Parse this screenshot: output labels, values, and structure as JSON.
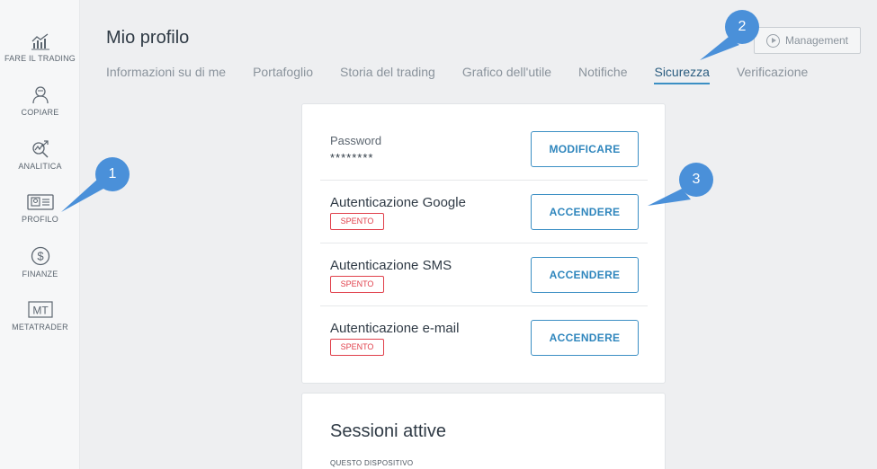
{
  "sidebar": {
    "items": [
      {
        "label": "FARE IL TRADING",
        "icon": "trading-chart-icon"
      },
      {
        "label": "COPIARE",
        "icon": "copy-user-icon"
      },
      {
        "label": "ANALITICA",
        "icon": "analytics-icon"
      },
      {
        "label": "PROFILO",
        "icon": "profile-card-icon"
      },
      {
        "label": "FINANZE",
        "icon": "dollar-icon"
      },
      {
        "label": "METATRADER",
        "icon": "mt-icon",
        "icon_text": "MT"
      }
    ]
  },
  "header": {
    "title": "Mio profilo",
    "management_label": "Management",
    "tabs": [
      {
        "label": "Informazioni su di me",
        "active": false
      },
      {
        "label": "Portafoglio",
        "active": false
      },
      {
        "label": "Storia del trading",
        "active": false
      },
      {
        "label": "Grafico dell'utile",
        "active": false
      },
      {
        "label": "Notifiche",
        "active": false
      },
      {
        "label": "Sicurezza",
        "active": true
      },
      {
        "label": "Verificazione",
        "active": false
      }
    ]
  },
  "security": {
    "password": {
      "label": "Password",
      "value": "********",
      "button": "MODIFICARE"
    },
    "google": {
      "label": "Autenticazione Google",
      "status": "SPENTO",
      "button": "ACCENDERE"
    },
    "sms": {
      "label": "Autenticazione SMS",
      "status": "SPENTO",
      "button": "ACCENDERE"
    },
    "email": {
      "label": "Autenticazione e-mail",
      "status": "SPENTO",
      "button": "ACCENDERE"
    }
  },
  "sessions": {
    "title": "Sessioni attive",
    "subtitle": "QUESTO DISPOSITIVO"
  },
  "callouts": [
    "1",
    "2",
    "3"
  ],
  "colors": {
    "accent": "#3b8fc4",
    "status_off": "#e0404b",
    "callout": "#4a90d9"
  }
}
